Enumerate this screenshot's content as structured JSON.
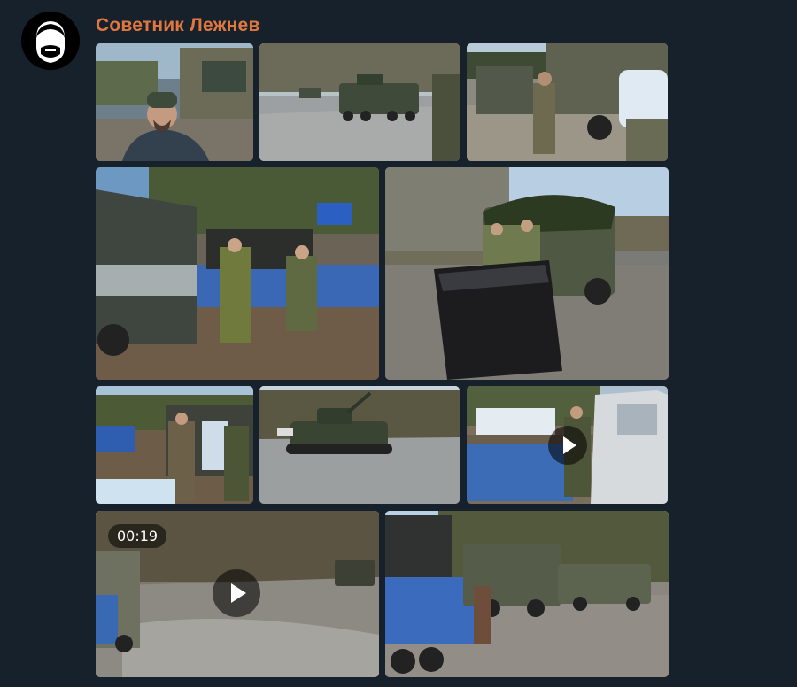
{
  "message": {
    "sender_name": "Советник Лежнев",
    "avatar_icon": "bearded-face-icon",
    "accent_color": "#e0773f"
  },
  "album": {
    "items": [
      {
        "kind": "photo",
        "scene": "selfie-with-armored-vehicle"
      },
      {
        "kind": "photo",
        "scene": "armored-vehicle-on-forest-road"
      },
      {
        "kind": "photo",
        "scene": "soldiers-unloading-water-from-truck"
      },
      {
        "kind": "photo",
        "scene": "loading-blue-truck-with-water"
      },
      {
        "kind": "photo",
        "scene": "camouflaged-truck-with-wrapped-cargo"
      },
      {
        "kind": "photo",
        "scene": "men-near-truck-with-water-bottles"
      },
      {
        "kind": "photo",
        "scene": "tank-on-forest-road"
      },
      {
        "kind": "video",
        "scene": "unloading-water-bottles",
        "duration": ""
      },
      {
        "kind": "video",
        "scene": "muddy-road-convoy",
        "duration": "00:19"
      },
      {
        "kind": "photo",
        "scene": "convoy-of-trucks-on-muddy-road"
      }
    ]
  }
}
